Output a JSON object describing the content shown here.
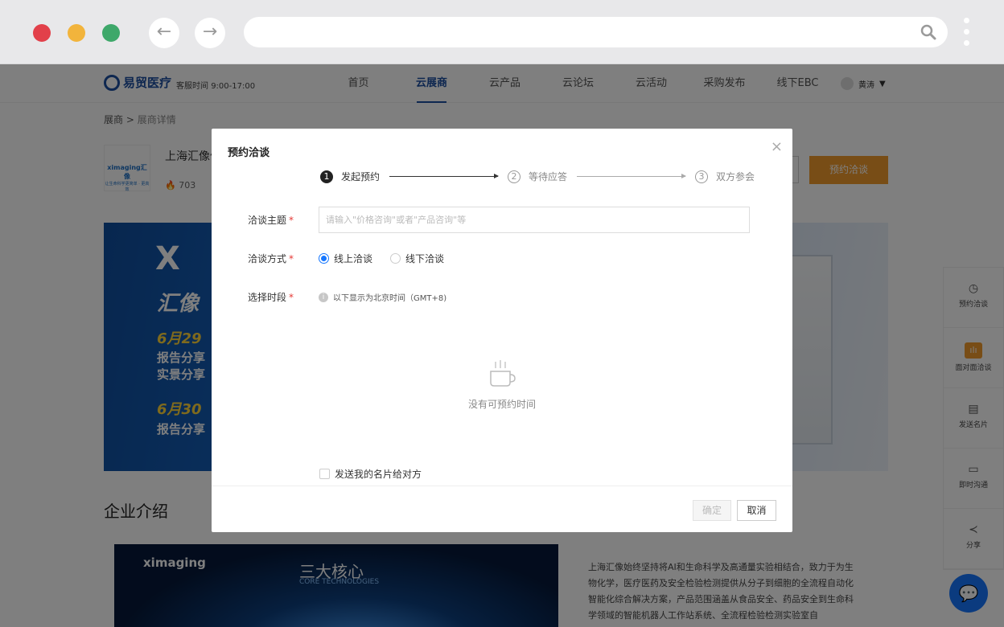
{
  "browser": {
    "dots": [
      "#e2404a",
      "#f2b43c",
      "#3ea86a"
    ],
    "back_glyph": "←",
    "forward_glyph": "→",
    "url": ""
  },
  "header": {
    "logo_name": "易贸医疗",
    "hours": "客服时间 9:00-17:00",
    "nav": [
      "首页",
      "云展商",
      "云产品",
      "云论坛",
      "云活动",
      "采购发布",
      "线下EBC"
    ],
    "active_index": 1,
    "user_name": "黄涛",
    "user_caret": "▼"
  },
  "breadcrumb": {
    "root": "展商",
    "sep": " > ",
    "current": "展商详情"
  },
  "company": {
    "logo_mark": "ximaging汇像",
    "logo_sub": "让生命科学更简单 · 更高效",
    "name": "上海汇像信",
    "views": "703",
    "appoint_button": "预约洽谈"
  },
  "banner": {
    "brand": "X",
    "title": "汇像",
    "date1": "6月29",
    "lines1": [
      "报告分享",
      "实景分享"
    ],
    "date2": "6月30",
    "line2": "报告分享"
  },
  "intro": {
    "title": "企业介绍",
    "img_logo": "ximaging",
    "img_caption": "三大核心",
    "img_caption_en": "CORE TECHNOLOGIES",
    "text": "上海汇像始终坚持将AI和生命科学及高通量实验相结合，致力于为生物化学，医疗医药及安全检验检测提供从分子到细胞的全流程自动化智能化综合解决方案，产品范围涵盖从食品安全、药品安全到生命科学领域的智能机器人工作站系统、全流程检验检测实验室自"
  },
  "side_toolbar": [
    {
      "icon": "clock-icon",
      "glyph": "◷",
      "label": "预约洽谈"
    },
    {
      "icon": "chart-icon",
      "glyph": "ılı",
      "label": "面对面洽谈"
    },
    {
      "icon": "card-icon",
      "glyph": "▤",
      "label": "发送名片"
    },
    {
      "icon": "chat-icon",
      "glyph": "▭",
      "label": "即时沟通"
    },
    {
      "icon": "share-icon",
      "glyph": "≺",
      "label": "分享"
    }
  ],
  "modal": {
    "title": "预约洽谈",
    "close": "×",
    "steps": [
      {
        "num": "1",
        "label": "发起预约"
      },
      {
        "num": "2",
        "label": "等待应答"
      },
      {
        "num": "3",
        "label": "双方参会"
      }
    ],
    "topic_label": "洽谈主题",
    "topic_placeholder": "请输入\"价格咨询\"或者\"产品咨询\"等",
    "topic_value": "",
    "mode_label": "洽谈方式",
    "mode_options": [
      "线上洽谈",
      "线下洽谈"
    ],
    "mode_selected": 0,
    "slot_label": "选择时段",
    "tz_icon": "i",
    "tz_note": "以下显示为北京时间（GMT+8)",
    "empty_text": "没有可预约时间",
    "send_card_label": "发送我的名片给对方",
    "send_card_checked": false,
    "ok_label": "确定",
    "cancel_label": "取消",
    "required_mark": "*"
  },
  "colors": {
    "brand_blue": "#1d4fa0",
    "accent_orange": "#f19a2c",
    "radio_blue": "#1677ff",
    "required_red": "#e53935"
  }
}
